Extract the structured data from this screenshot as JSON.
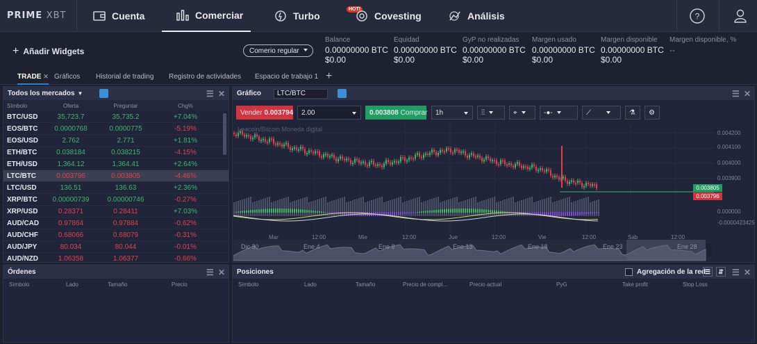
{
  "brand": {
    "name": "PRIME",
    "sub": "XBT"
  },
  "nav": [
    {
      "label": "Cuenta"
    },
    {
      "label": "Comerciar"
    },
    {
      "label": "Turbo"
    },
    {
      "label": "Covesting",
      "badge": "HOT!"
    },
    {
      "label": "Análisis"
    }
  ],
  "toolbar": {
    "add_widgets": "Añadir Widgets",
    "mode": "Comerio regular"
  },
  "stats": [
    {
      "label": "Balance",
      "btc": "0.00000000 BTC",
      "usd": "$0.00"
    },
    {
      "label": "Equidad",
      "btc": "0.00000000 BTC",
      "usd": "$0.00"
    },
    {
      "label": "GyP no realizadas",
      "btc": "0.00000000 BTC",
      "usd": "$0.00"
    },
    {
      "label": "Margen usado",
      "btc": "0.00000000 BTC",
      "usd": "$0.00"
    },
    {
      "label": "Margen disponible",
      "btc": "0.00000000 BTC",
      "usd": "$0.00"
    },
    {
      "label": "Margen disponible, %",
      "btc": "--",
      "usd": ""
    }
  ],
  "tabs": [
    "TRADE",
    "Gráficos",
    "Historial de trading",
    "Registro de actividades",
    "Espacio de trabajo 1"
  ],
  "markets": {
    "title": "Todos los mercados",
    "columns": [
      "Símbolo",
      "Oferta",
      "Preguntar",
      "Chg%"
    ],
    "rows": [
      {
        "sym": "BTC/USD",
        "bid": "35,723.7",
        "ask": "35,735.2",
        "chg": "+7.04%",
        "dir": "up"
      },
      {
        "sym": "EOS/BTC",
        "bid": "0.0000768",
        "ask": "0.0000775",
        "chg": "-5.19%",
        "dir": "up"
      },
      {
        "sym": "EOS/USD",
        "bid": "2.762",
        "ask": "2.771",
        "chg": "+1.81%",
        "dir": "up"
      },
      {
        "sym": "ETH/BTC",
        "bid": "0.038184",
        "ask": "0.038215",
        "chg": "-4.15%",
        "dir": "up"
      },
      {
        "sym": "ETH/USD",
        "bid": "1,364.12",
        "ask": "1,364.41",
        "chg": "+2.64%",
        "dir": "up"
      },
      {
        "sym": "LTC/BTC",
        "bid": "0.003796",
        "ask": "0.003805",
        "chg": "-4.46%",
        "dir": "down"
      },
      {
        "sym": "LTC/USD",
        "bid": "136.51",
        "ask": "136.63",
        "chg": "+2.36%",
        "dir": "up"
      },
      {
        "sym": "XRP/BTC",
        "bid": "0.00000739",
        "ask": "0.00000746",
        "chg": "-0.27%",
        "dir": "up"
      },
      {
        "sym": "XRP/USD",
        "bid": "0.28371",
        "ask": "0.28411",
        "chg": "+7.03%",
        "dir": "down"
      },
      {
        "sym": "AUD/CAD",
        "bid": "0.97864",
        "ask": "0.97884",
        "chg": "-0.62%",
        "dir": "down"
      },
      {
        "sym": "AUD/CHF",
        "bid": "0.68066",
        "ask": "0.68079",
        "chg": "-0.31%",
        "dir": "down"
      },
      {
        "sym": "AUD/JPY",
        "bid": "80.034",
        "ask": "80.044",
        "chg": "-0.01%",
        "dir": "down"
      },
      {
        "sym": "AUD/NZD",
        "bid": "1.06358",
        "ask": "1.06377",
        "chg": "-0.66%",
        "dir": "down"
      }
    ]
  },
  "chart": {
    "title": "Gráfico",
    "symbol": "LTC/BTC",
    "sell_label": "Vender",
    "sell_price": "0.003794",
    "qty": "2.00",
    "buy_price": "0.003808",
    "buy_label": "Comprar",
    "interval": "1h",
    "watermark": "Leacoin/Bitcoin Moneda digital",
    "yticks": [
      "0.004200",
      "0.004100",
      "0.004000",
      "0.003900",
      "0.000000",
      "-0.0000423425"
    ],
    "xticks": [
      "Mar",
      "12:00",
      "Mie",
      "12:00",
      "Jue",
      "12:00",
      "Vie",
      "12:00",
      "Sab",
      "12:00"
    ],
    "nav_labels": [
      "Dic 30",
      "Ene 4",
      "Ene 8",
      "Ene 13",
      "Ene 18",
      "Ene 23",
      "Ene 28"
    ],
    "price_ask": "0.003805",
    "price_bid": "0.003796"
  },
  "orders": {
    "title": "Órdenes",
    "columns": [
      "Símbolo",
      "Lado",
      "Tamaño",
      "Precio"
    ]
  },
  "positions": {
    "title": "Posiciones",
    "aggregation": "Agregación de la red",
    "columns": [
      "Símbolo",
      "Lado",
      "Tamaño",
      "Precio de compl...",
      "Precio actual",
      "PyG",
      "Take profit",
      "Stop Loss"
    ]
  },
  "colors": {
    "up": "#3fb56a",
    "down": "#e0414a",
    "bg": "#1d2130"
  },
  "chart_data": {
    "type": "line",
    "title": "",
    "series": [
      {
        "name": "LTC/BTC",
        "values": [
          0.00418,
          0.00415,
          0.00412,
          0.00408,
          0.00405,
          0.00402,
          0.00399,
          0.00397,
          0.00395,
          0.00398,
          0.00401,
          0.00404,
          0.00406,
          0.00402,
          0.00399,
          0.00396,
          0.00394,
          0.00392,
          0.00385,
          0.00382,
          0.0038
        ]
      }
    ]
  }
}
